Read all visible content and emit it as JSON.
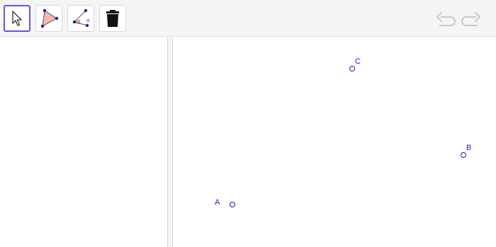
{
  "toolbar": {
    "tools": [
      {
        "name": "move-tool",
        "icon": "arrow-cursor-icon",
        "selected": true
      },
      {
        "name": "polygon-tool",
        "icon": "polygon-icon",
        "selected": false
      },
      {
        "name": "angle-tool",
        "icon": "angle-icon",
        "selected": false
      },
      {
        "name": "delete-tool",
        "icon": "trash-icon",
        "selected": false
      }
    ],
    "undo_icon": "undo-icon",
    "redo_icon": "redo-icon"
  },
  "colors": {
    "selected_border": "#6557d2",
    "point_stroke": "#1a1aa6",
    "label": "#1a1add",
    "polygon_fill": "#f4b6b0",
    "disabled_icon": "#c8c8c8"
  },
  "graphics": {
    "points": [
      {
        "label": "A"
      },
      {
        "label": "B"
      },
      {
        "label": "C"
      }
    ]
  }
}
